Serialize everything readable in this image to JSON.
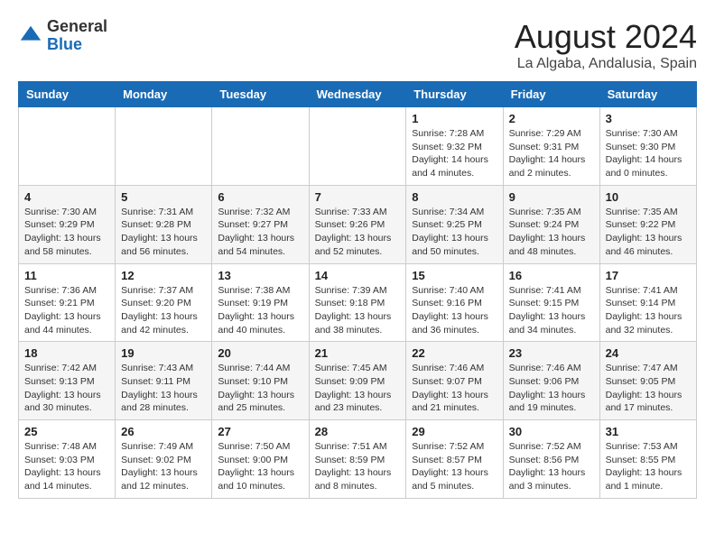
{
  "header": {
    "logo": {
      "line1": "General",
      "line2": "Blue"
    },
    "title": "August 2024",
    "subtitle": "La Algaba, Andalusia, Spain"
  },
  "days_of_week": [
    "Sunday",
    "Monday",
    "Tuesday",
    "Wednesday",
    "Thursday",
    "Friday",
    "Saturday"
  ],
  "weeks": [
    [
      {
        "day": "",
        "info": ""
      },
      {
        "day": "",
        "info": ""
      },
      {
        "day": "",
        "info": ""
      },
      {
        "day": "",
        "info": ""
      },
      {
        "day": "1",
        "info": "Sunrise: 7:28 AM\nSunset: 9:32 PM\nDaylight: 14 hours\nand 4 minutes."
      },
      {
        "day": "2",
        "info": "Sunrise: 7:29 AM\nSunset: 9:31 PM\nDaylight: 14 hours\nand 2 minutes."
      },
      {
        "day": "3",
        "info": "Sunrise: 7:30 AM\nSunset: 9:30 PM\nDaylight: 14 hours\nand 0 minutes."
      }
    ],
    [
      {
        "day": "4",
        "info": "Sunrise: 7:30 AM\nSunset: 9:29 PM\nDaylight: 13 hours\nand 58 minutes."
      },
      {
        "day": "5",
        "info": "Sunrise: 7:31 AM\nSunset: 9:28 PM\nDaylight: 13 hours\nand 56 minutes."
      },
      {
        "day": "6",
        "info": "Sunrise: 7:32 AM\nSunset: 9:27 PM\nDaylight: 13 hours\nand 54 minutes."
      },
      {
        "day": "7",
        "info": "Sunrise: 7:33 AM\nSunset: 9:26 PM\nDaylight: 13 hours\nand 52 minutes."
      },
      {
        "day": "8",
        "info": "Sunrise: 7:34 AM\nSunset: 9:25 PM\nDaylight: 13 hours\nand 50 minutes."
      },
      {
        "day": "9",
        "info": "Sunrise: 7:35 AM\nSunset: 9:24 PM\nDaylight: 13 hours\nand 48 minutes."
      },
      {
        "day": "10",
        "info": "Sunrise: 7:35 AM\nSunset: 9:22 PM\nDaylight: 13 hours\nand 46 minutes."
      }
    ],
    [
      {
        "day": "11",
        "info": "Sunrise: 7:36 AM\nSunset: 9:21 PM\nDaylight: 13 hours\nand 44 minutes."
      },
      {
        "day": "12",
        "info": "Sunrise: 7:37 AM\nSunset: 9:20 PM\nDaylight: 13 hours\nand 42 minutes."
      },
      {
        "day": "13",
        "info": "Sunrise: 7:38 AM\nSunset: 9:19 PM\nDaylight: 13 hours\nand 40 minutes."
      },
      {
        "day": "14",
        "info": "Sunrise: 7:39 AM\nSunset: 9:18 PM\nDaylight: 13 hours\nand 38 minutes."
      },
      {
        "day": "15",
        "info": "Sunrise: 7:40 AM\nSunset: 9:16 PM\nDaylight: 13 hours\nand 36 minutes."
      },
      {
        "day": "16",
        "info": "Sunrise: 7:41 AM\nSunset: 9:15 PM\nDaylight: 13 hours\nand 34 minutes."
      },
      {
        "day": "17",
        "info": "Sunrise: 7:41 AM\nSunset: 9:14 PM\nDaylight: 13 hours\nand 32 minutes."
      }
    ],
    [
      {
        "day": "18",
        "info": "Sunrise: 7:42 AM\nSunset: 9:13 PM\nDaylight: 13 hours\nand 30 minutes."
      },
      {
        "day": "19",
        "info": "Sunrise: 7:43 AM\nSunset: 9:11 PM\nDaylight: 13 hours\nand 28 minutes."
      },
      {
        "day": "20",
        "info": "Sunrise: 7:44 AM\nSunset: 9:10 PM\nDaylight: 13 hours\nand 25 minutes."
      },
      {
        "day": "21",
        "info": "Sunrise: 7:45 AM\nSunset: 9:09 PM\nDaylight: 13 hours\nand 23 minutes."
      },
      {
        "day": "22",
        "info": "Sunrise: 7:46 AM\nSunset: 9:07 PM\nDaylight: 13 hours\nand 21 minutes."
      },
      {
        "day": "23",
        "info": "Sunrise: 7:46 AM\nSunset: 9:06 PM\nDaylight: 13 hours\nand 19 minutes."
      },
      {
        "day": "24",
        "info": "Sunrise: 7:47 AM\nSunset: 9:05 PM\nDaylight: 13 hours\nand 17 minutes."
      }
    ],
    [
      {
        "day": "25",
        "info": "Sunrise: 7:48 AM\nSunset: 9:03 PM\nDaylight: 13 hours\nand 14 minutes."
      },
      {
        "day": "26",
        "info": "Sunrise: 7:49 AM\nSunset: 9:02 PM\nDaylight: 13 hours\nand 12 minutes."
      },
      {
        "day": "27",
        "info": "Sunrise: 7:50 AM\nSunset: 9:00 PM\nDaylight: 13 hours\nand 10 minutes."
      },
      {
        "day": "28",
        "info": "Sunrise: 7:51 AM\nSunset: 8:59 PM\nDaylight: 13 hours\nand 8 minutes."
      },
      {
        "day": "29",
        "info": "Sunrise: 7:52 AM\nSunset: 8:57 PM\nDaylight: 13 hours\nand 5 minutes."
      },
      {
        "day": "30",
        "info": "Sunrise: 7:52 AM\nSunset: 8:56 PM\nDaylight: 13 hours\nand 3 minutes."
      },
      {
        "day": "31",
        "info": "Sunrise: 7:53 AM\nSunset: 8:55 PM\nDaylight: 13 hours\nand 1 minute."
      }
    ]
  ]
}
